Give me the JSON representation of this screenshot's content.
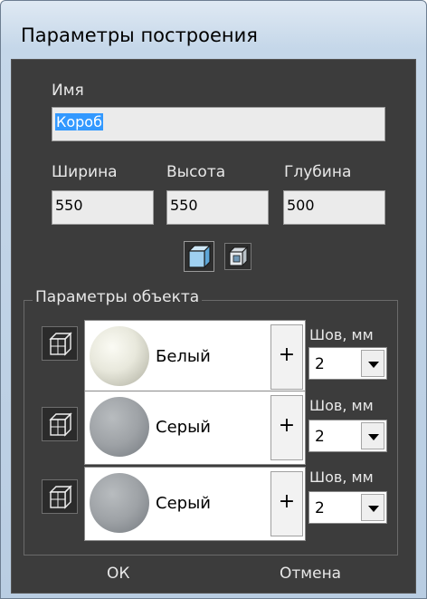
{
  "window": {
    "title": "Параметры построения"
  },
  "name_field": {
    "label": "Имя",
    "value": "Короб"
  },
  "dimensions": {
    "width": {
      "label": "Ширина",
      "value": "550"
    },
    "height": {
      "label": "Высота",
      "value": "550"
    },
    "depth": {
      "label": "Глубина",
      "value": "500"
    }
  },
  "view_toggles": [
    "cube-solid-icon",
    "cube-inner-icon"
  ],
  "object_params": {
    "group_label": "Параметры объекта",
    "rows": [
      {
        "material": "Белый",
        "swatch_color": "#e8e8dc",
        "seam_label": "Шов, мм",
        "seam_value": "2",
        "plus": "+"
      },
      {
        "material": "Серый",
        "swatch_color": "#9ea2a6",
        "seam_label": "Шов, мм",
        "seam_value": "2",
        "plus": "+"
      },
      {
        "material": "Серый",
        "swatch_color": "#9ea2a6",
        "seam_label": "Шов, мм",
        "seam_value": "2",
        "plus": "+"
      }
    ]
  },
  "buttons": {
    "ok": "ОК",
    "cancel": "Отмена"
  },
  "colors": {
    "panel_bg": "#3c3c3c",
    "text": "#e8e8e8",
    "selection": "#3399ff"
  }
}
